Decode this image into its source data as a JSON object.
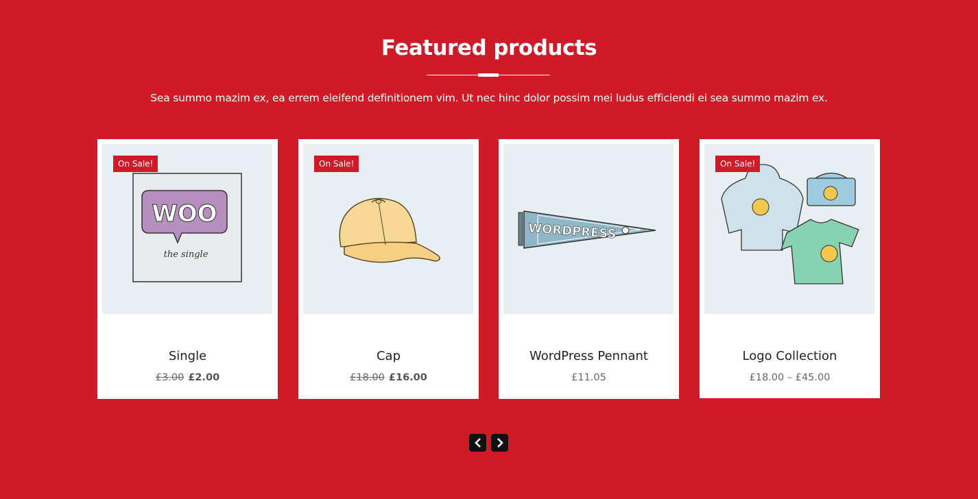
{
  "section": {
    "title": "Featured products",
    "intro": "Sea summo mazim ex, ea errem eleifend definitionem vim. Ut nec hinc dolor possim mei ludus efficiendi ei sea summo mazim ex."
  },
  "products": [
    {
      "name": "Single",
      "badge": "On Sale!",
      "old_price": "£3.00",
      "price": "£2.00",
      "image_text_1": "WOO",
      "image_text_2": "the single"
    },
    {
      "name": "Cap",
      "badge": "On Sale!",
      "old_price": "£18.00",
      "price": "£16.00"
    },
    {
      "name": "WordPress Pennant",
      "price": "£11.05",
      "image_text": "WORDPRESS"
    },
    {
      "name": "Logo Collection",
      "badge": "On Sale!",
      "price": "£18.00 – £45.00"
    }
  ],
  "carousel": {
    "prev_icon": "chevron-left-icon",
    "next_icon": "chevron-right-icon"
  },
  "colors": {
    "background": "#cf1b27",
    "badge": "#cf1b27",
    "card": "#ffffff",
    "thumb_bg": "#e8eef2"
  }
}
